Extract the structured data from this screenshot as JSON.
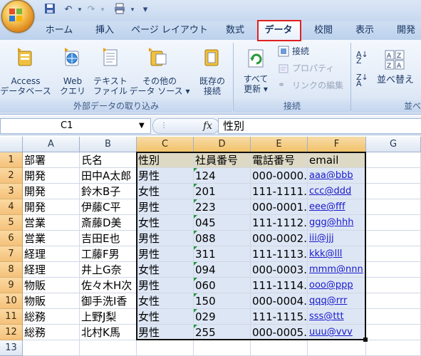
{
  "qat": {
    "save_icon": "save-icon",
    "undo_icon": "undo-icon",
    "redo_icon": "redo-icon",
    "print_icon": "print-icon",
    "more": "▾"
  },
  "tabs": [
    "ホーム",
    "挿入",
    "ページ レイアウト",
    "数式",
    "データ",
    "校閲",
    "表示",
    "開発"
  ],
  "active_tab": "データ",
  "ribbon": {
    "external_data": {
      "access": "Access\nデータベース",
      "web": "Web\nクエリ",
      "text": "テキスト\nファイル",
      "other": "その他の\nデータ ソース ▾",
      "existing": "既存の\n接続",
      "group_label": "外部データの取り込み"
    },
    "connections": {
      "refresh_all": "すべて\n更新 ▾",
      "connections": "接続",
      "properties": "プロパティ",
      "edit_links": "リンクの編集",
      "group_label": "接続"
    },
    "sort": {
      "sort": "並べ替え",
      "group_label": "並べ"
    }
  },
  "formula_bar": {
    "name_box": "C1",
    "fx": "fx",
    "value": "性別"
  },
  "columns": [
    "A",
    "B",
    "C",
    "D",
    "E",
    "F",
    "G"
  ],
  "rows": [
    {
      "n": "1",
      "cells": [
        "部署",
        "氏名",
        "性別",
        "社員番号",
        "電話番号",
        "email"
      ]
    },
    {
      "n": "2",
      "cells": [
        "開発",
        "田中A太郎",
        "男性",
        "124",
        "000-0000.",
        "aaa@bbb"
      ]
    },
    {
      "n": "3",
      "cells": [
        "開発",
        "鈴木B子",
        "女性",
        "201",
        "111-1111.",
        "ccc@ddd"
      ]
    },
    {
      "n": "4",
      "cells": [
        "開発",
        "伊藤C平",
        "男性",
        "223",
        "000-0001.",
        "eee@fff"
      ]
    },
    {
      "n": "5",
      "cells": [
        "営業",
        "斎藤D美",
        "女性",
        "045",
        "111-1112.",
        "ggg@hhh"
      ]
    },
    {
      "n": "6",
      "cells": [
        "営業",
        "吉田E也",
        "男性",
        "088",
        "000-0002.",
        "iii@jjj"
      ]
    },
    {
      "n": "7",
      "cells": [
        "経理",
        "工藤F男",
        "男性",
        "311",
        "111-1113.",
        "kkk@lll"
      ]
    },
    {
      "n": "8",
      "cells": [
        "経理",
        "井上G奈",
        "女性",
        "094",
        "000-0003.",
        "mmm@nnn"
      ]
    },
    {
      "n": "9",
      "cells": [
        "物販",
        "佐々木H次",
        "男性",
        "060",
        "111-1114.",
        "ooo@ppp"
      ]
    },
    {
      "n": "10",
      "cells": [
        "物販",
        "御手洗I香",
        "女性",
        "150",
        "000-0004.",
        "qqq@rrr"
      ]
    },
    {
      "n": "11",
      "cells": [
        "総務",
        "上野J梨",
        "女性",
        "029",
        "111-1115.",
        "sss@ttt"
      ]
    },
    {
      "n": "12",
      "cells": [
        "総務",
        "北村K馬",
        "男性",
        "255",
        "000-0005.",
        "uuu@vvv"
      ]
    },
    {
      "n": "13",
      "cells": [
        "",
        "",
        "",
        "",
        "",
        ""
      ]
    }
  ]
}
